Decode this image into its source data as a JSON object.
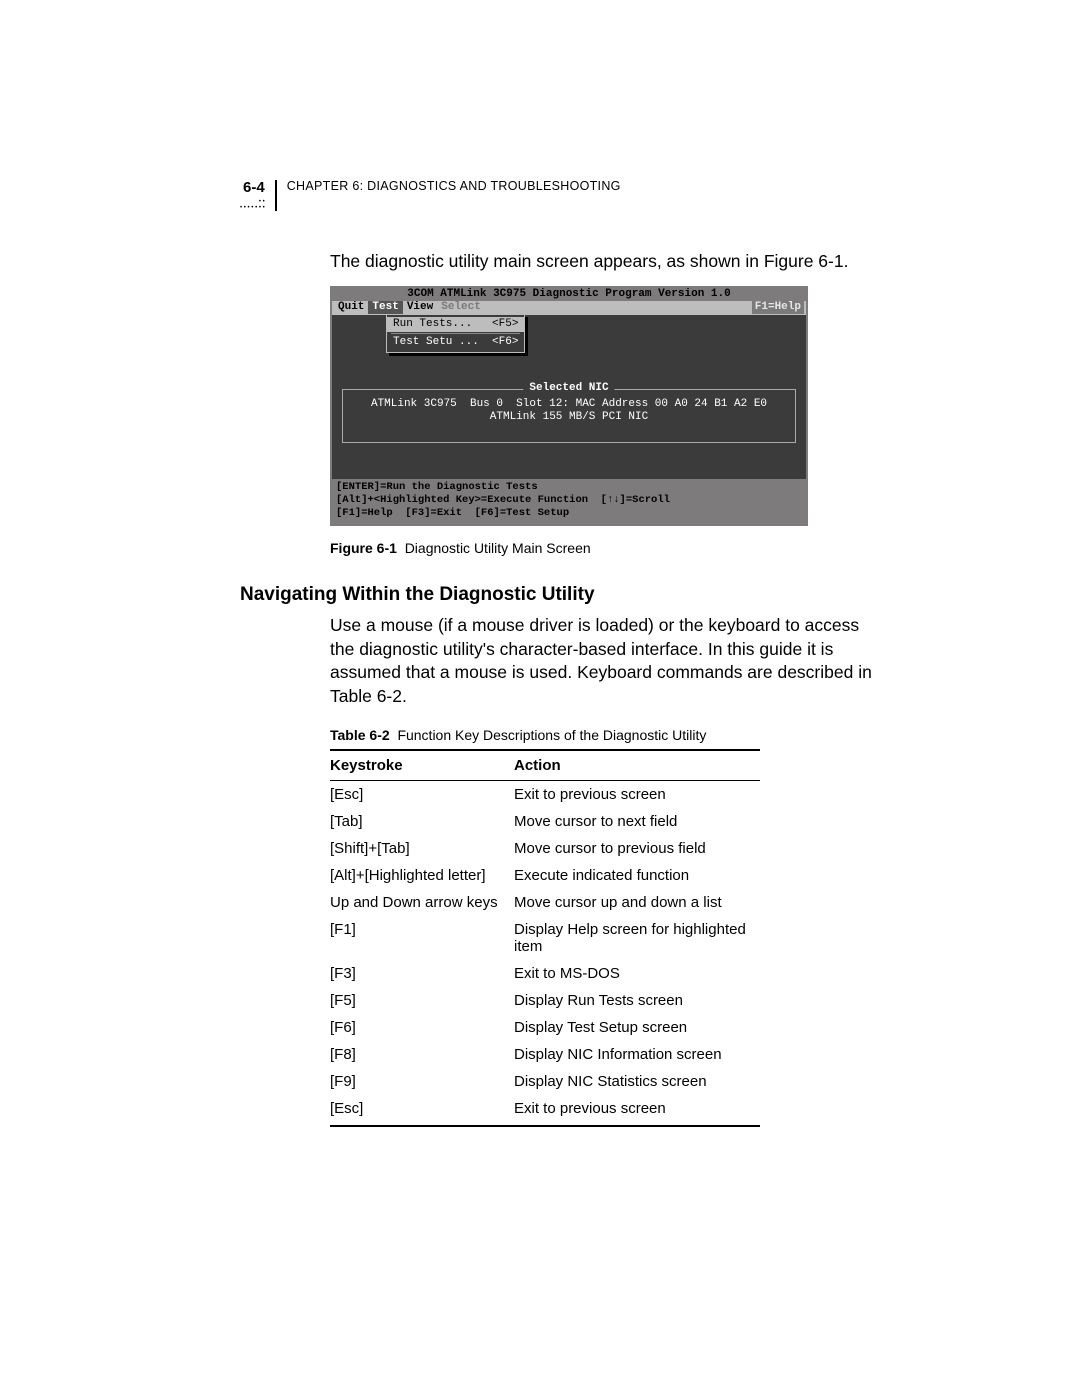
{
  "header": {
    "page_number": "6-4",
    "chapter_label": "Chapter 6: Diagnostics and Troubleshooting"
  },
  "intro": "The diagnostic utility main screen appears, as shown in Figure 6-1.",
  "screenshot": {
    "title": "3COM ATMLink 3C975 Diagnostic Program Version 1.0",
    "menu": {
      "items": [
        "Quit",
        "Test",
        "View",
        "Select"
      ],
      "active_index": 1,
      "help": "F1=Help"
    },
    "dropdown": {
      "items": [
        {
          "label": "Run Tests...   <F5>",
          "selected": true
        },
        {
          "label": "Test Setu ...  <F6>",
          "selected": false
        }
      ]
    },
    "fieldset_title": "Selected NIC",
    "nic_line1": "ATMLink 3C975  Bus 0  Slot 12: MAC Address 00 A0 24 B1 A2 E0",
    "nic_line2": "ATMLink 155 MB/S PCI NIC",
    "footer_line1": "[ENTER]=Run the Diagnostic Tests",
    "footer_line2": "[Alt]+<Highlighted Key>=Execute Function  [↑↓]=Scroll",
    "footer_line3": "[F1]=Help  [F3]=Exit  [F6]=Test Setup"
  },
  "figure_caption": {
    "label": "Figure 6-1",
    "text": "Diagnostic Utility Main Screen"
  },
  "section_heading": "Navigating Within the Diagnostic Utility",
  "section_para": "Use a mouse (if a mouse driver is loaded) or the keyboard to access the diagnostic utility's character-based interface. In this guide it is assumed that a mouse is used. Keyboard commands are described in Table 6-2.",
  "table_caption": {
    "label": "Table 6-2",
    "text": "Function Key Descriptions of the Diagnostic Utility"
  },
  "table": {
    "headers": {
      "col1": "Keystroke",
      "col2": "Action"
    },
    "rows": [
      {
        "k": "[Esc]",
        "a": "Exit to previous screen"
      },
      {
        "k": "[Tab]",
        "a": "Move cursor to next field"
      },
      {
        "k": "[Shift]+[Tab]",
        "a": "Move cursor to previous field"
      },
      {
        "k": "[Alt]+[Highlighted letter]",
        "a": "Execute indicated function"
      },
      {
        "k": "Up and Down arrow keys",
        "a": "Move cursor up and down a list"
      },
      {
        "k": "[F1]",
        "a": "Display Help screen for highlighted item"
      },
      {
        "k": "[F3]",
        "a": "Exit to MS-DOS"
      },
      {
        "k": "[F5]",
        "a": "Display Run Tests screen"
      },
      {
        "k": "[F6]",
        "a": "Display Test Setup screen"
      },
      {
        "k": "[F8]",
        "a": "Display NIC Information screen"
      },
      {
        "k": "[F9]",
        "a": "Display NIC Statistics screen"
      },
      {
        "k": "[Esc]",
        "a": "Exit to previous screen"
      }
    ]
  }
}
